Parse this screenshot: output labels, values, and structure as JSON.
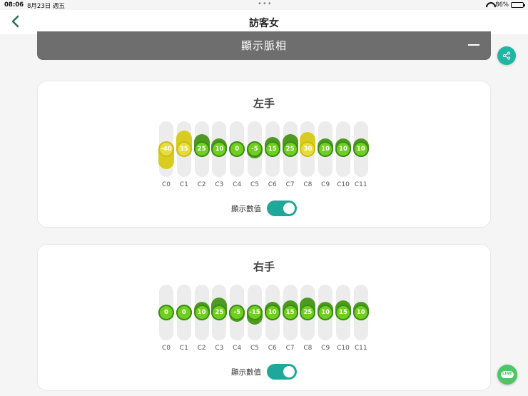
{
  "status_bar": {
    "time": "08:06",
    "date": "8月23日 週五",
    "battery": "86%",
    "battery_level": 0.86
  },
  "nav": {
    "title": "訪客女"
  },
  "banner": {
    "label": "顯示脈相"
  },
  "cards": [
    {
      "title": "左手",
      "toggle_label": "顯示數值",
      "channels": [
        {
          "label": "C0",
          "value": "-40",
          "color": "yellow"
        },
        {
          "label": "C1",
          "value": "35",
          "color": "yellow"
        },
        {
          "label": "C2",
          "value": "25",
          "color": "green"
        },
        {
          "label": "C3",
          "value": "10",
          "color": "green"
        },
        {
          "label": "C4",
          "value": "0",
          "color": "green"
        },
        {
          "label": "C5",
          "value": "-5",
          "color": "green"
        },
        {
          "label": "C6",
          "value": "15",
          "color": "green"
        },
        {
          "label": "C7",
          "value": "25",
          "color": "green"
        },
        {
          "label": "C8",
          "value": "30",
          "color": "yellow"
        },
        {
          "label": "C9",
          "value": "10",
          "color": "green"
        },
        {
          "label": "C10",
          "value": "10",
          "color": "green"
        },
        {
          "label": "C11",
          "value": "10",
          "color": "green"
        }
      ]
    },
    {
      "title": "右手",
      "toggle_label": "顯示數值",
      "channels": [
        {
          "label": "C0",
          "value": "0",
          "color": "green"
        },
        {
          "label": "C1",
          "value": "0",
          "color": "green"
        },
        {
          "label": "C2",
          "value": "10",
          "color": "green"
        },
        {
          "label": "C3",
          "value": "25",
          "color": "green"
        },
        {
          "label": "C4",
          "value": "-5",
          "color": "green"
        },
        {
          "label": "C5",
          "value": "-15",
          "color": "green"
        },
        {
          "label": "C6",
          "value": "10",
          "color": "green"
        },
        {
          "label": "C7",
          "value": "15",
          "color": "green"
        },
        {
          "label": "C8",
          "value": "25",
          "color": "green"
        },
        {
          "label": "C9",
          "value": "10",
          "color": "green"
        },
        {
          "label": "C10",
          "value": "15",
          "color": "green"
        },
        {
          "label": "C11",
          "value": "10",
          "color": "green"
        }
      ]
    }
  ],
  "icons": {
    "back": "chevron-left-icon",
    "share": "share-icon",
    "collapse": "minus-icon",
    "line": "line-chat-icon"
  },
  "line_button": {
    "label": "LINE"
  },
  "colors": {
    "accent": "#1fa89a",
    "green": "#6fcf1e",
    "yellow": "#e8dc3a",
    "banner": "#6e6e6e"
  }
}
